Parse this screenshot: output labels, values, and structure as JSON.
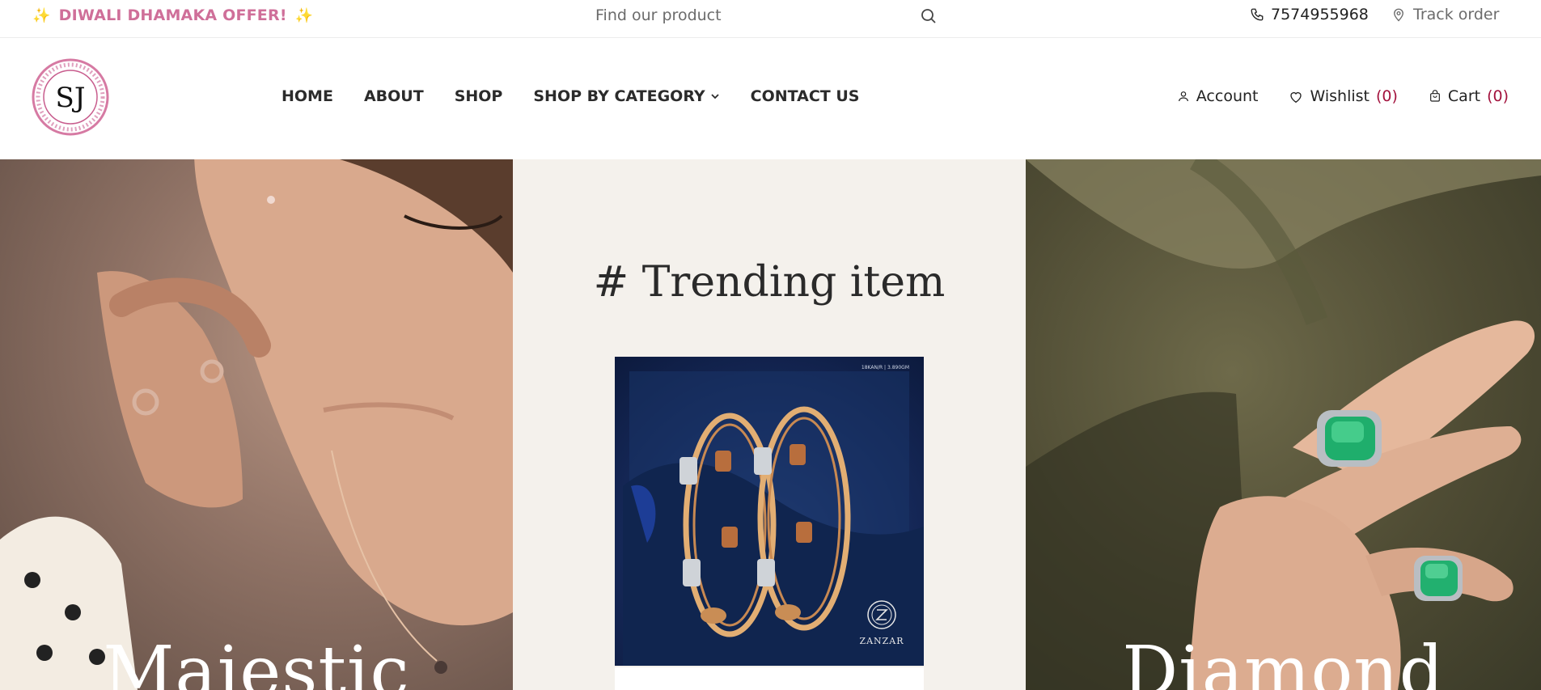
{
  "topbar": {
    "offer_text": "DIWALI DHAMAKA OFFER!",
    "search_placeholder": "Find our product",
    "phone": "7574955968",
    "track_order": "Track order"
  },
  "header": {
    "logo_text": "SJ",
    "nav": [
      "HOME",
      "ABOUT",
      "SHOP",
      "SHOP BY CATEGORY",
      "CONTACT US"
    ],
    "account": "Account",
    "wishlist": "Wishlist",
    "wishlist_count": "(0)",
    "cart": "Cart",
    "cart_count": "(0)"
  },
  "hero": {
    "left_caption": "Majestic",
    "center_title": "# Trending item",
    "right_caption": "Diamond",
    "product_meta": "18KAN/R | 3.890GM",
    "brand": "ZANZAR"
  },
  "colors": {
    "offer_pink": "#cf6f99",
    "count_red": "#a3123d",
    "center_bg": "#f4f1ec"
  },
  "icons": [
    "sparkle-icon",
    "search-icon",
    "phone-icon",
    "location-pin-icon",
    "chevron-down-icon",
    "user-icon",
    "heart-icon",
    "bag-icon"
  ]
}
